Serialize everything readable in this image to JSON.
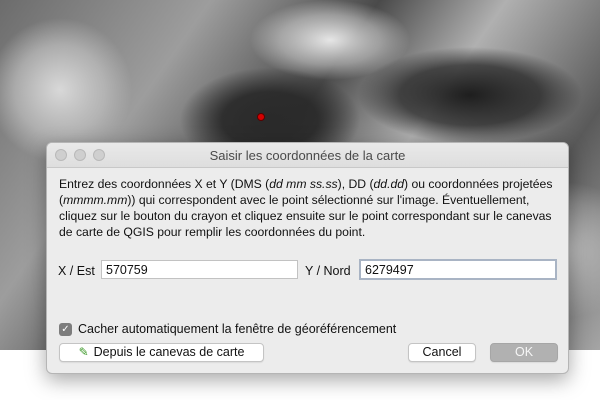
{
  "dialog": {
    "title": "Saisir les coordonnées de la carte",
    "instructions": {
      "p1": "Entrez des coordonnées X et Y (DMS (",
      "p1_i": "dd mm ss.ss",
      "p2": "), DD (",
      "p2_i": "dd.dd",
      "p3": ") ou coordonnées projetées (",
      "p3_i": "mmmm.mm",
      "p4": ")) qui correspondent avec le point sélectionné sur l'image. Éventuellement, cliquez sur le bouton du crayon et cliquez ensuite sur le point correspondant sur le canevas de carte de QGIS pour remplir les coordonnées du point."
    },
    "x_label": "X / Est",
    "x_value": "570759",
    "y_label": "Y / Nord",
    "y_value": "6279497",
    "auto_hide_label": "Cacher automatiquement la fenêtre de géoréférencement",
    "auto_hide_checked": true,
    "from_canvas_label": "Depuis le canevas de carte",
    "cancel_label": "Cancel",
    "ok_label": "OK",
    "icons": {
      "auto_hide_check": "✓",
      "pencil": "✎"
    }
  },
  "colors": {
    "gcp_point": "#d40000",
    "pencil": "#3f9a2b"
  }
}
